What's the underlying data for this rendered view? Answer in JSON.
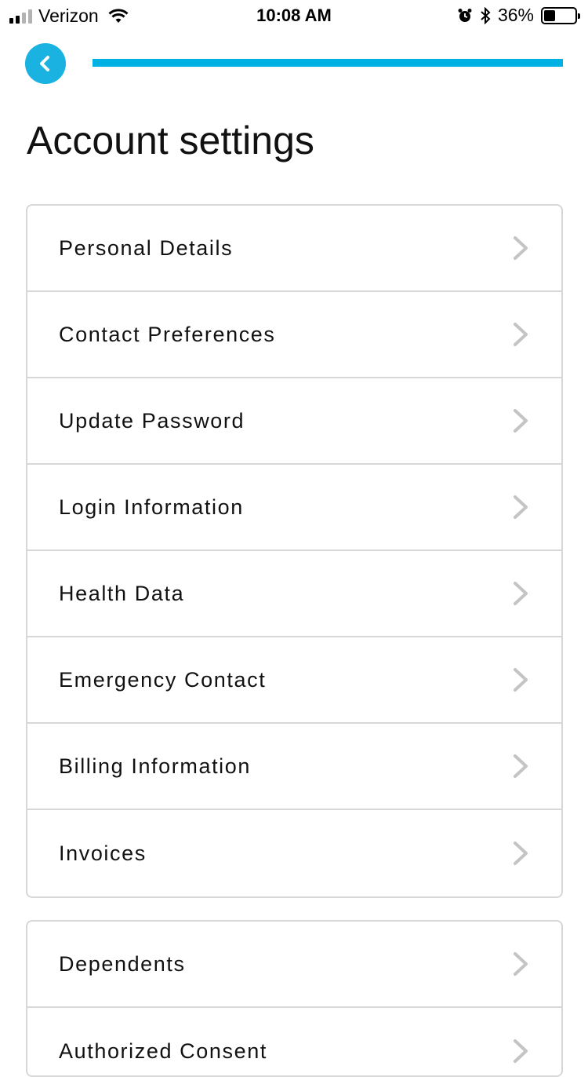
{
  "status_bar": {
    "carrier": "Verizon",
    "time": "10:08 AM",
    "battery_percent": "36%",
    "battery_level": 0.36,
    "signal_bars": 4,
    "signal_bars_filled": 2
  },
  "header": {
    "back_icon": "chevron-left-icon",
    "progress": 1.0,
    "accent_color": "#00b2e3"
  },
  "page": {
    "title": "Account settings"
  },
  "settings_group_1": [
    {
      "label": "Personal Details"
    },
    {
      "label": "Contact Preferences"
    },
    {
      "label": "Update Password"
    },
    {
      "label": "Login Information"
    },
    {
      "label": "Health Data"
    },
    {
      "label": "Emergency Contact"
    },
    {
      "label": "Billing Information"
    },
    {
      "label": "Invoices"
    }
  ],
  "settings_group_2": [
    {
      "label": "Dependents"
    },
    {
      "label": "Authorized Consent"
    }
  ]
}
